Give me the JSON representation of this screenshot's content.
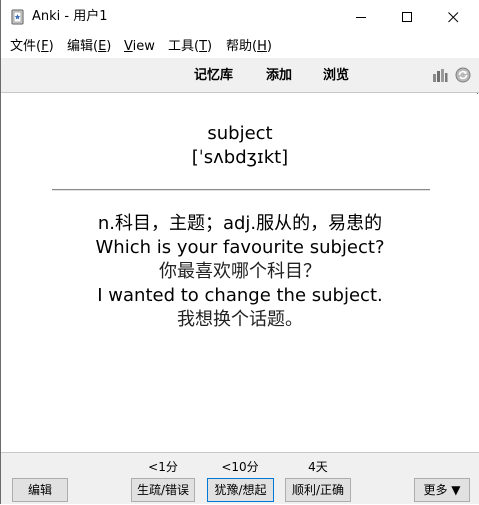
{
  "window": {
    "title": "Anki - 用户1"
  },
  "menu": {
    "file": {
      "label": "文件(",
      "accel": "F",
      "end": ")"
    },
    "edit": {
      "label": "编辑(",
      "accel": "E",
      "end": ")"
    },
    "view": {
      "accel": "V",
      "label": "iew"
    },
    "tools": {
      "label": "工具(",
      "accel": "T",
      "end": ")"
    },
    "help": {
      "label": "帮助(",
      "accel": "H",
      "end": ")"
    }
  },
  "toolbar": {
    "decks": "记忆库",
    "add": "添加",
    "browse": "浏览",
    "icons": [
      "stats-icon",
      "sync-icon"
    ]
  },
  "card": {
    "word": "subject",
    "phonetic": "[ˈsʌbdʒɪkt]",
    "meaning": "n.科目，主题；adj.服从的，易患的",
    "example1": "Which is your favourite subject?",
    "example1_cn": "你最喜欢哪个科目？",
    "example2": "I wanted to change the subject.",
    "example2_cn": "我想换个话题。"
  },
  "answer_bar": {
    "edit": "编辑",
    "again_interval": "<1分",
    "again": "生疏/错误",
    "hard_interval": "<10分",
    "hard": "犹豫/想起",
    "good_interval": "4天",
    "good": "顺利/正确",
    "more": "更多 ▼"
  },
  "colors": {
    "toolbar_bg": "#f0f0f0",
    "button_bg": "#e1e1e1",
    "focus_border": "#0078d7"
  }
}
